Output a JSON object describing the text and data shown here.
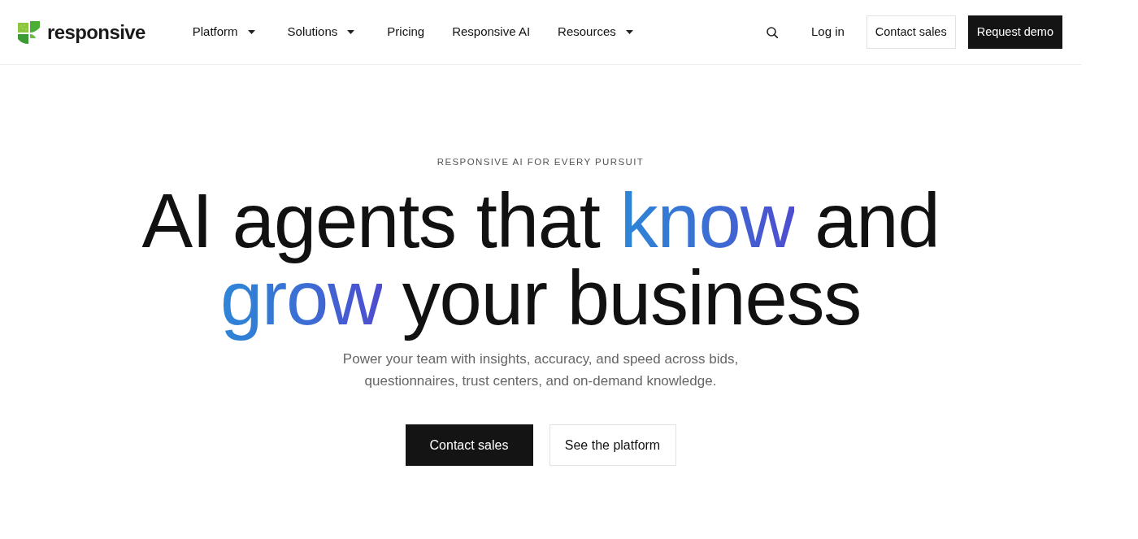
{
  "header": {
    "logo": {
      "text": "responsive"
    },
    "nav": [
      {
        "label": "Platform",
        "dropdown": true
      },
      {
        "label": "Solutions",
        "dropdown": true
      },
      {
        "label": "Pricing",
        "dropdown": false
      },
      {
        "label": "Responsive AI",
        "dropdown": false
      },
      {
        "label": "Resources",
        "dropdown": true
      }
    ],
    "login": "Log in",
    "buttons": [
      {
        "label": "Contact sales",
        "kind": "outline"
      },
      {
        "label": "Request demo",
        "kind": "solid"
      }
    ]
  },
  "hero": {
    "eyebrow": "RESPONSIVE AI FOR EVERY PURSUIT",
    "headline": [
      [
        {
          "text": "AI agents that",
          "highlight": false
        },
        {
          "text": "know",
          "highlight": true
        },
        {
          "text": "and",
          "highlight": false
        }
      ],
      [
        {
          "text": "grow",
          "highlight": true
        },
        {
          "text": "your business",
          "highlight": false
        }
      ]
    ],
    "subtitle": "Power your team with insights, accuracy, and speed across bids, questionnaires, trust centers, and on-demand knowledge.",
    "buttons": [
      {
        "label": "Contact sales",
        "kind": "solid"
      },
      {
        "label": "See the platform",
        "kind": "outline"
      }
    ]
  }
}
